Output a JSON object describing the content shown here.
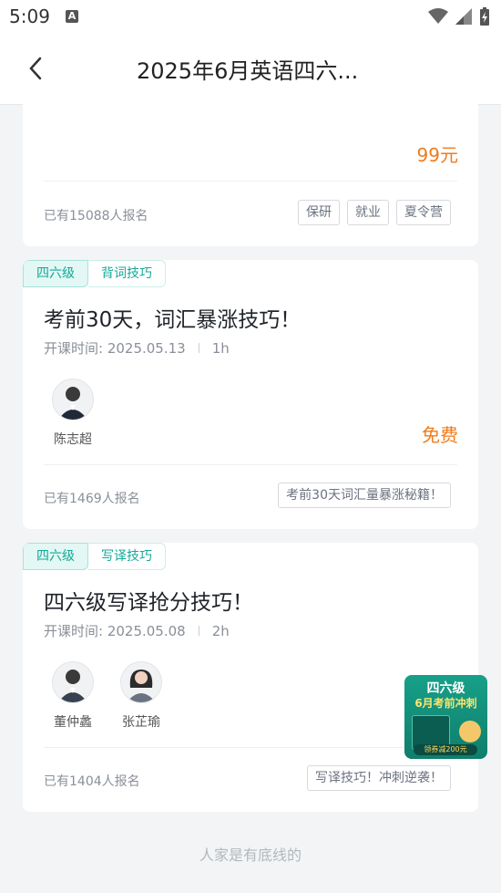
{
  "status_bar": {
    "time": "5:09",
    "notification_icon": "A"
  },
  "header": {
    "title": "2025年6月英语四六..."
  },
  "card1": {
    "price": "99元",
    "enrolled": "已有15088人报名",
    "tags": [
      "保研",
      "就业",
      "夏令营"
    ]
  },
  "card2": {
    "category": "四六级",
    "topic": "背词技巧",
    "title": "考前30天，词汇暴涨技巧！",
    "time": "开课时间: 2025.05.13",
    "duration": "1h",
    "teachers": [
      "陈志超"
    ],
    "price": "免费",
    "enrolled": "已有1469人报名",
    "tag": "考前30天词汇量暴涨秘籍！"
  },
  "card3": {
    "category": "四六级",
    "topic": "写译技巧",
    "title": "四六级写译抢分技巧！",
    "time": "开课时间: 2025.05.08",
    "duration": "2h",
    "teachers": [
      "董仲蠡",
      "张芷瑜"
    ],
    "enrolled": "已有1404人报名",
    "tag": "写译技巧！冲刺逆袭！"
  },
  "promo": {
    "line1": "四六级",
    "line2": "6月考前冲刺",
    "button": "领券减200元"
  },
  "footer": "人家是有底线的"
}
